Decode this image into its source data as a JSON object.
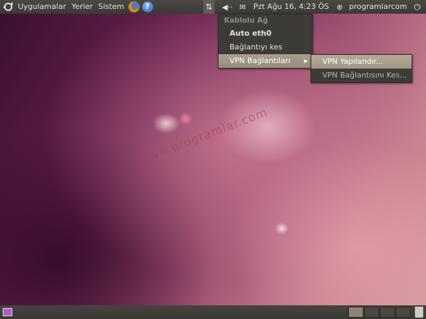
{
  "top_panel": {
    "menus": [
      "Uygulamalar",
      "Yerler",
      "Sistem"
    ],
    "clock": "Pzt Ağu 16,  4:23 ÖS",
    "user": "programlarcom"
  },
  "network_menu": {
    "header": "Kablolu Ağ",
    "items": [
      {
        "label": "Auto eth0"
      },
      {
        "label": "Bağlantıyı kes"
      },
      {
        "label": "VPN Bağlantıları"
      }
    ]
  },
  "vpn_submenu": {
    "items": [
      {
        "label": "VPN Yapılandır..."
      },
      {
        "label": "VPN Bağlantısını Kes..."
      }
    ]
  },
  "watermark": "www.programlar.com",
  "icons": {
    "ubuntu": "ubuntu-logo-icon",
    "firefox": "firefox-icon",
    "help": "help-icon",
    "network": "network-icon",
    "volume": "volume-icon",
    "mail": "mail-icon",
    "power": "power-icon",
    "trash": "trash-icon"
  }
}
